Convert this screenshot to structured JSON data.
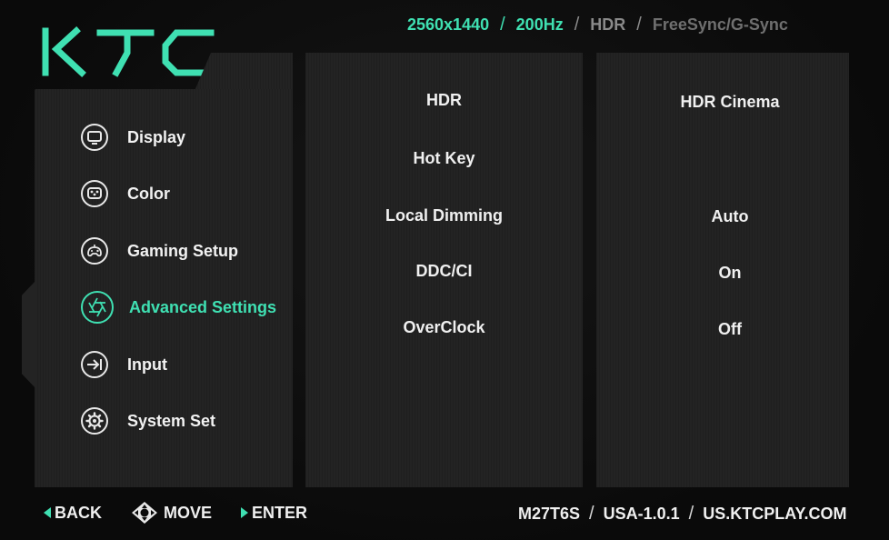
{
  "logo": {
    "brand": "KTC",
    "color": "#3fe0b2"
  },
  "specs": [
    {
      "label": "2560x1440",
      "style": "accent"
    },
    {
      "label": "200Hz",
      "style": "accent"
    },
    {
      "label": "HDR",
      "style": "dim"
    },
    {
      "label": "FreeSync/G-Sync",
      "style": "dim2"
    }
  ],
  "menu": {
    "items": [
      {
        "label": "Display",
        "icon": "monitor-icon"
      },
      {
        "label": "Color",
        "icon": "color-palette-icon"
      },
      {
        "label": "Gaming Setup",
        "icon": "gamepad-icon"
      },
      {
        "label": "Advanced Settings",
        "icon": "aperture-icon",
        "active": true
      },
      {
        "label": "Input",
        "icon": "input-arrow-icon"
      },
      {
        "label": "System Set",
        "icon": "gear-icon"
      }
    ]
  },
  "options": {
    "items": [
      {
        "label": "HDR"
      },
      {
        "label": "Hot Key"
      },
      {
        "label": "Local Dimming"
      },
      {
        "label": "DDC/CI"
      },
      {
        "label": "OverClock"
      }
    ]
  },
  "values": {
    "hdr": "HDR Cinema",
    "local_dimming": "Auto",
    "ddc_ci": "On",
    "overclock": "Off"
  },
  "footer": {
    "back": "BACK",
    "move": "MOVE",
    "enter": "ENTER",
    "model": "M27T6S",
    "firmware": "USA-1.0.1",
    "website": "US.KTCPLAY.COM"
  },
  "colors": {
    "accent": "#3fe0b2",
    "panel": "#232323",
    "background": "#0b0b0b",
    "text": "#f0f0f0"
  }
}
